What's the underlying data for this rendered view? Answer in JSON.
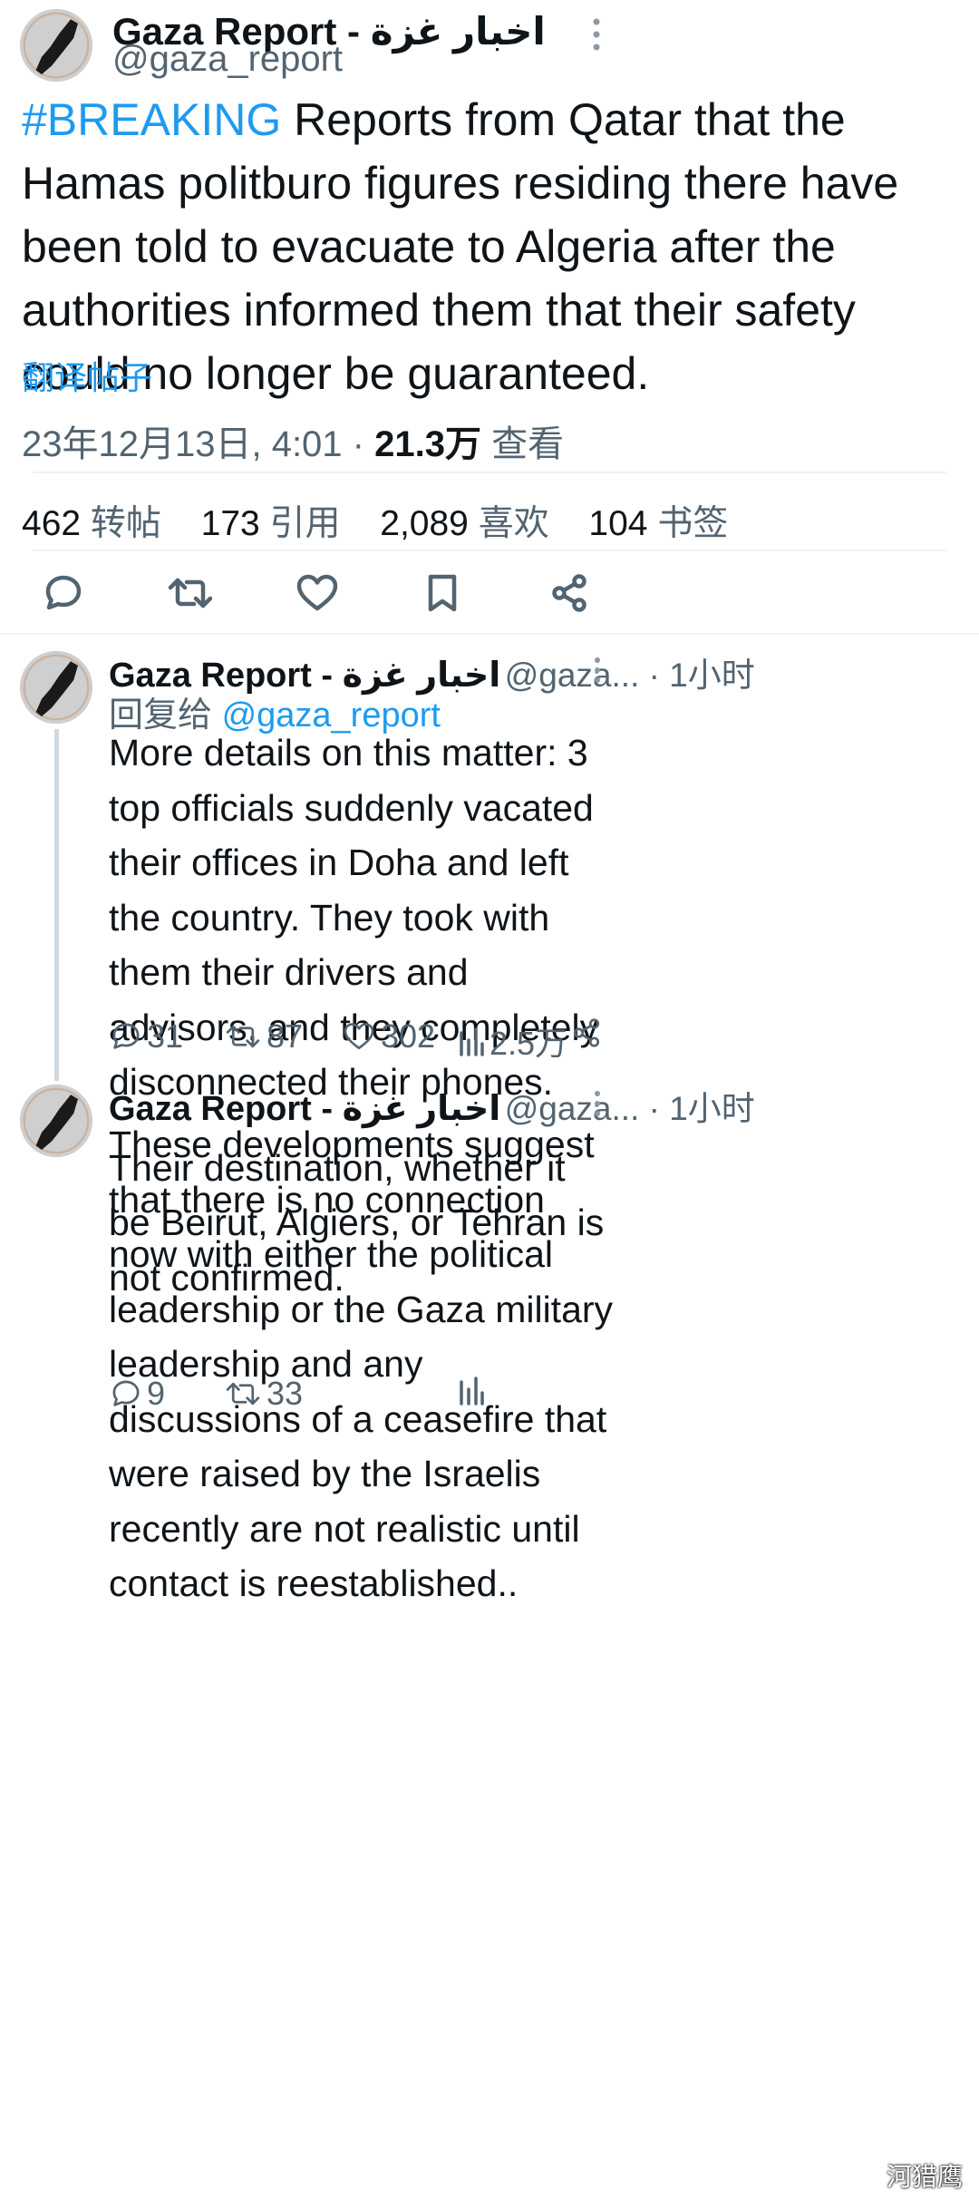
{
  "main_tweet": {
    "author_name": "Gaza Report - اخبار غزة",
    "handle": "@gaza_report",
    "hashtag": "#BREAKING",
    "text": " Reports from Qatar that the Hamas politburo figures residing there have been told to evacuate to Algeria after the authorities informed them that their safety could no longer be guaranteed.",
    "translate_label": "翻译帖子",
    "timestamp": "23年12月13日, 4:01 · ",
    "views_count": "21.3万",
    "views_label": " 查看",
    "stats": {
      "retweets": "462",
      "retweets_label": "转帖",
      "quotes": "173",
      "quotes_label": "引用",
      "likes": "2,089",
      "likes_label": "喜欢",
      "bookmarks": "104",
      "bookmarks_label": "书签"
    }
  },
  "replies": [
    {
      "author_name": "Gaza Report - اخبار غزة",
      "handle_time": "@gaza... · 1小时",
      "reply_to_prefix": "回复给 ",
      "reply_to_handle": "@gaza_report",
      "text_p1": "More details on this matter: 3 top officials suddenly vacated their offices in Doha and left the country. They took with them their drivers and advisors, and they completely disconnected their phones.",
      "text_p2": "Their destination, whether it be Beirut, Algiers, or Tehran is not confirmed.",
      "replies": "31",
      "retweets": "87",
      "likes": "302",
      "views": "2.5万"
    },
    {
      "author_name": "Gaza Report - اخبار غزة",
      "handle_time": "@gaza... · 1小时",
      "text_p1": "These developments suggest that there is no connection now with either the political leadership or the Gaza military leadership and any discussions of a ceasefire that were raised by the Israelis recently are not realistic until contact is reestablished..",
      "replies": "9",
      "retweets": "33"
    }
  ],
  "watermark": "河猎鹰",
  "colors": {
    "link": "#1d9bf0",
    "muted": "#536471",
    "divider": "#eff3f4"
  }
}
